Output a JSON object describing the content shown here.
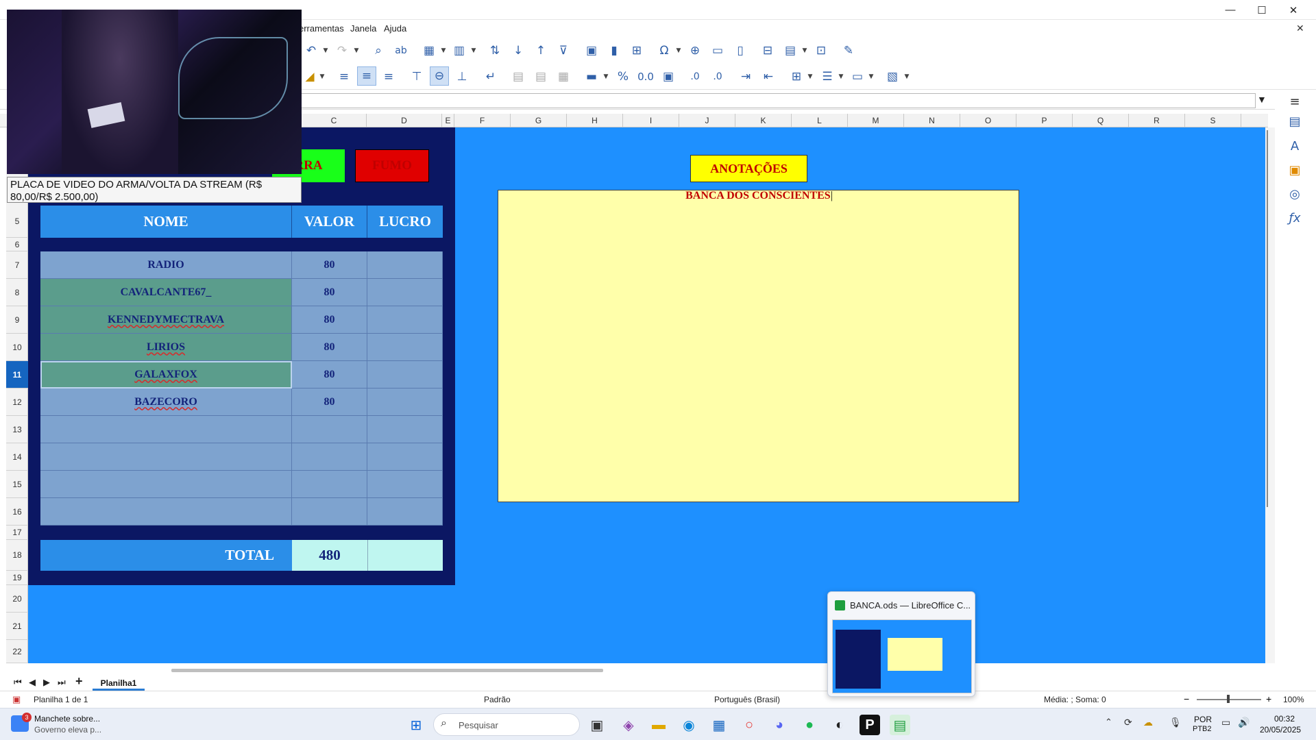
{
  "window": {
    "title": "BANCA.ods — LibreOffice Calc",
    "minimize": "—",
    "maximize": "☐",
    "close": "✕",
    "doc_close": "✕"
  },
  "menu": {
    "items": [
      "erramentas",
      "Janela",
      "Ajuda"
    ]
  },
  "table": {
    "buttons": [
      {
        "label": "RRA",
        "color": "#19ff19"
      },
      {
        "label": "FUMO",
        "color": "#e00000"
      }
    ],
    "headers": [
      "NOME",
      "VALOR",
      "LUCRO"
    ],
    "rows": [
      {
        "nome": "RADIO",
        "valor": "80",
        "lucro": ""
      },
      {
        "nome": "CAVALCANTE67_",
        "valor": "80",
        "lucro": ""
      },
      {
        "nome": "KENNEDYMECTRAVA",
        "valor": "80",
        "lucro": ""
      },
      {
        "nome": "LIRIOS",
        "valor": "80",
        "lucro": ""
      },
      {
        "nome": "GALAXFOX",
        "valor": "80",
        "lucro": ""
      },
      {
        "nome": "BAZECORO",
        "valor": "80",
        "lucro": ""
      },
      {
        "nome": "",
        "valor": "",
        "lucro": ""
      },
      {
        "nome": "",
        "valor": "",
        "lucro": ""
      },
      {
        "nome": "",
        "valor": "",
        "lucro": ""
      },
      {
        "nome": "",
        "valor": "",
        "lucro": ""
      }
    ],
    "total_label": "TOTAL",
    "total_value": "480",
    "total_lucro": ""
  },
  "notes": {
    "label": "ANOTAÇÕES",
    "title": "BANCA DOS CONSCIENTES"
  },
  "columns": [
    "C",
    "D",
    "E",
    "F",
    "G",
    "H",
    "I",
    "J",
    "K",
    "L",
    "M",
    "N",
    "O",
    "P",
    "Q",
    "R",
    "S"
  ],
  "rows_visible": [
    "5",
    "6",
    "7",
    "8",
    "9",
    "10",
    "11",
    "12",
    "13",
    "14",
    "15",
    "16",
    "17",
    "18",
    "19",
    "20",
    "21",
    "22"
  ],
  "active_row": "11",
  "sheet": {
    "tab": "Planilha1",
    "add": "+"
  },
  "status": {
    "sheet_info": "Planilha 1 de 1",
    "style": "Padrão",
    "language": "Português (Brasil)",
    "summary": "Média: ; Soma: 0",
    "zoom": "100%"
  },
  "webcam_caption": "PLACA DE VIDEO DO ARMA/VOLTA DA STREAM (R$ 80,00/R$ 2.500,00)",
  "taskbar": {
    "news_title": "Manchete sobre...",
    "news_sub": "Governo eleva p...",
    "news_badge": "3",
    "search_placeholder": "Pesquisar",
    "lang": "POR",
    "lang_sub": "PTB2",
    "time": "00:32",
    "date": "20/05/2025"
  },
  "thumbnail": {
    "title": "BANCA.ods — LibreOffice C..."
  }
}
